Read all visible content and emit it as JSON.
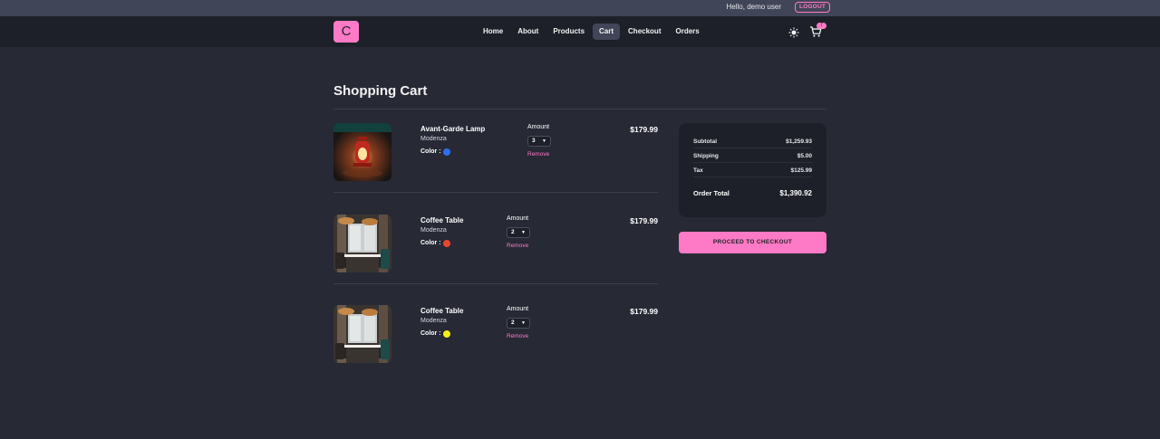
{
  "topbar": {
    "greeting": "Hello, demo user",
    "logout_label": "LOGOUT"
  },
  "navbar": {
    "logo": "C",
    "links": [
      "Home",
      "About",
      "Products",
      "Cart",
      "Checkout",
      "Orders"
    ],
    "active_link": "Cart",
    "theme_icon": "sun-icon",
    "cart_icon": "shopping-cart-icon",
    "cart_count": "7"
  },
  "page": {
    "title": "Shopping Cart"
  },
  "cart": {
    "items": [
      {
        "name": "Avant-Garde Lamp",
        "company": "Modenza",
        "color_label": "Color :",
        "color": "#2f6df2",
        "amount_label": "Amount",
        "amount": "3",
        "remove_label": "Remove",
        "price": "$179.99"
      },
      {
        "name": "Coffee Table",
        "company": "Modenza",
        "color_label": "Color :",
        "color": "#e8462f",
        "amount_label": "Amount",
        "amount": "2",
        "remove_label": "Remove",
        "price": "$179.99"
      },
      {
        "name": "Coffee Table",
        "company": "Modenza",
        "color_label": "Color :",
        "color": "#f5ef16",
        "amount_label": "Amount",
        "amount": "2",
        "remove_label": "Remove",
        "price": "$179.99"
      }
    ]
  },
  "summary": {
    "subtotal_label": "Subtotal",
    "subtotal": "$1,259.93",
    "shipping_label": "Shipping",
    "shipping": "$5.00",
    "tax_label": "Tax",
    "tax": "$125.99",
    "total_label": "Order Total",
    "total": "$1,390.92"
  },
  "checkout_button": "PROCEED TO CHECKOUT",
  "colors": {
    "accent": "#ff7ac6",
    "background": "#272935",
    "navbar": "#1e2029",
    "topbar": "#414558"
  }
}
